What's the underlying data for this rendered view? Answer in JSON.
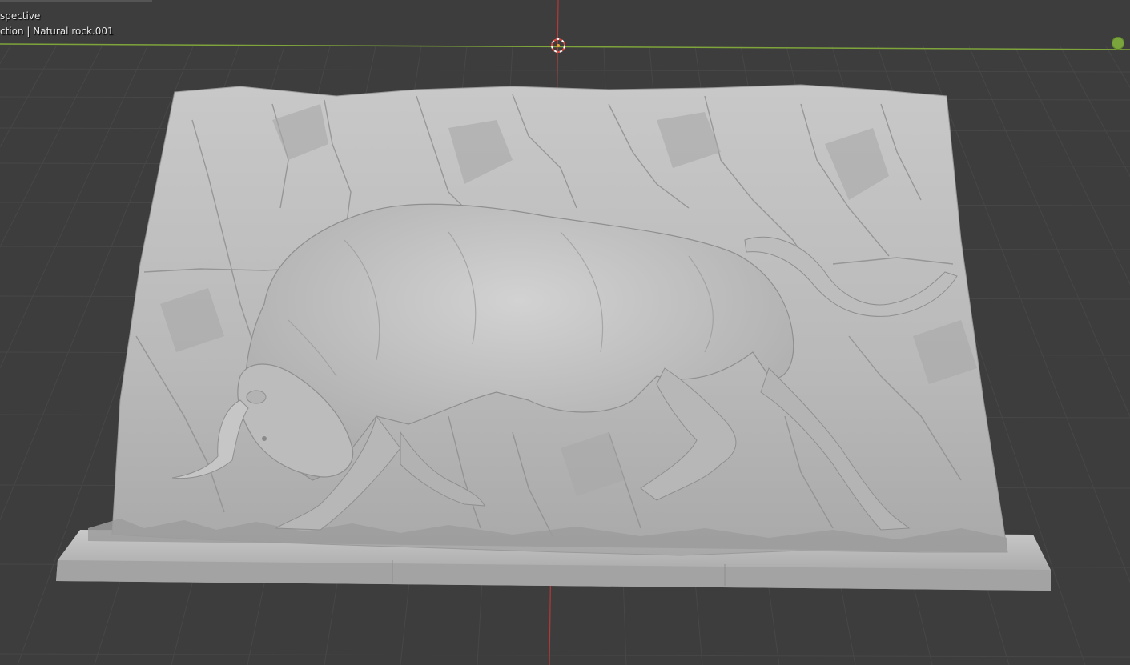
{
  "viewport": {
    "view_label": "spective",
    "collection_label": "ction | Natural rock.001"
  },
  "colors": {
    "background": "#3d3d3d",
    "grid_line": "#4a4a4a",
    "x_axis": "#8bb13f",
    "y_axis": "#c23b3b",
    "mesh": "#bdbdbd"
  },
  "icons": {
    "cursor": "3d-cursor-icon",
    "gizmo": "navigation-gizmo-icon"
  }
}
